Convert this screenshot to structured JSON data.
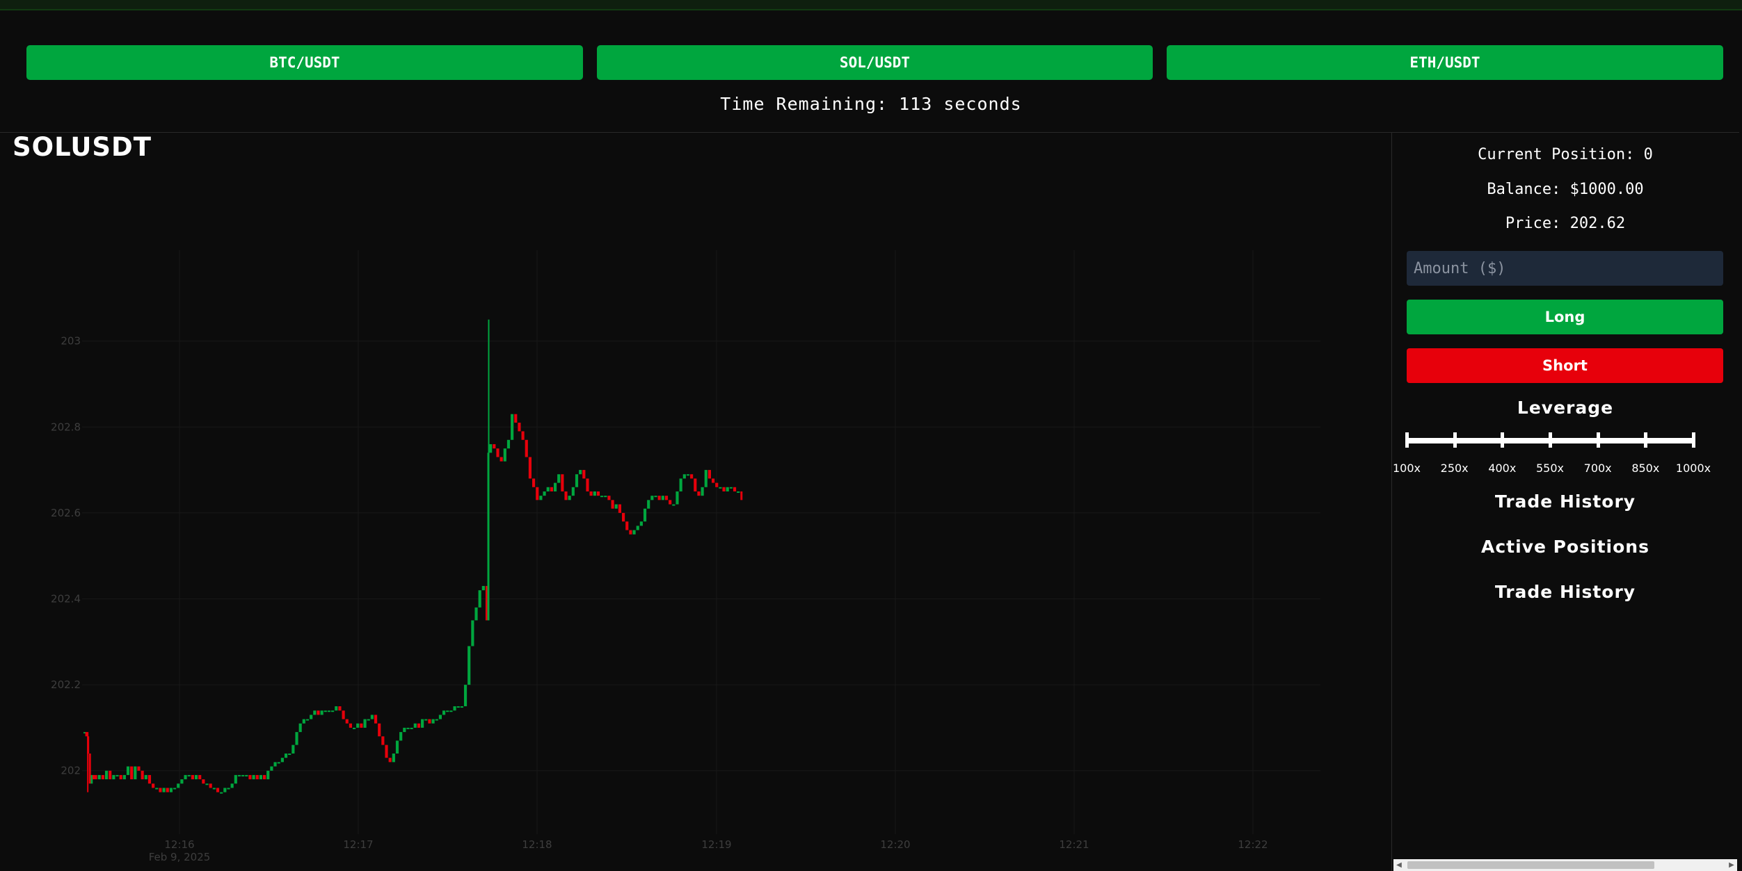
{
  "pairs": [
    {
      "label": "BTC/USDT"
    },
    {
      "label": "SOL/USDT"
    },
    {
      "label": "ETH/USDT"
    }
  ],
  "timer": {
    "text": "Time Remaining: 113 seconds"
  },
  "symbol": "SOLUSDT",
  "panel": {
    "position": "Current Position: 0",
    "balance": "Balance: $1000.00",
    "price": "Price: 202.62",
    "amount_placeholder": "Amount ($)",
    "long_label": "Long",
    "short_label": "Short",
    "leverage_title": "Leverage",
    "leverage_options": [
      "100x",
      "250x",
      "400x",
      "550x",
      "700x",
      "850x",
      "1000x"
    ],
    "leverage_selected": "1000x",
    "trade_history_title": "Trade History",
    "active_positions_title": "Active Positions",
    "trade_history_title_2": "Trade History"
  },
  "colors": {
    "up": "#00a63e",
    "down": "#e7000b",
    "background": "#0c0c0c",
    "input_bg": "#1e2939"
  },
  "chart_data": {
    "type": "candlestick",
    "y_ticks": [
      "203",
      "202.8",
      "202.6",
      "202.4",
      "202.2",
      "202"
    ],
    "x_ticks": [
      "12:16",
      "12:17",
      "12:18",
      "12:19",
      "12:20",
      "12:21",
      "12:22"
    ],
    "x_sublabel": "Feb 9, 2025",
    "ylim": [
      201.93,
      203.09
    ],
    "grid": true,
    "path": [
      [
        0,
        202.09
      ],
      [
        1,
        202.09
      ],
      [
        2,
        202.08
      ],
      [
        3,
        202.04
      ],
      [
        4,
        201.97
      ],
      [
        5,
        201.99
      ],
      [
        8,
        201.98
      ],
      [
        10,
        201.99
      ],
      [
        12,
        201.98
      ],
      [
        14,
        202.0
      ],
      [
        16,
        201.98
      ],
      [
        18,
        201.99
      ],
      [
        20,
        201.99
      ],
      [
        22,
        201.98
      ],
      [
        24,
        201.99
      ],
      [
        26,
        202.01
      ],
      [
        28,
        201.98
      ],
      [
        30,
        202.01
      ],
      [
        32,
        202.0
      ],
      [
        34,
        201.98
      ],
      [
        36,
        201.99
      ],
      [
        38,
        201.97
      ],
      [
        40,
        201.96
      ],
      [
        42,
        201.96
      ],
      [
        44,
        201.95
      ],
      [
        46,
        201.96
      ],
      [
        48,
        201.95
      ],
      [
        50,
        201.96
      ],
      [
        52,
        201.96
      ],
      [
        54,
        201.97
      ],
      [
        56,
        201.98
      ],
      [
        58,
        201.99
      ],
      [
        60,
        201.99
      ],
      [
        62,
        201.98
      ],
      [
        64,
        201.99
      ],
      [
        66,
        201.98
      ],
      [
        68,
        201.97
      ],
      [
        70,
        201.97
      ],
      [
        72,
        201.96
      ],
      [
        74,
        201.96
      ],
      [
        76,
        201.95
      ],
      [
        78,
        201.95
      ],
      [
        80,
        201.96
      ],
      [
        82,
        201.96
      ],
      [
        84,
        201.97
      ],
      [
        86,
        201.99
      ],
      [
        88,
        201.99
      ],
      [
        90,
        201.99
      ],
      [
        92,
        201.99
      ],
      [
        94,
        201.98
      ],
      [
        96,
        201.99
      ],
      [
        98,
        201.98
      ],
      [
        100,
        201.99
      ],
      [
        102,
        201.98
      ],
      [
        104,
        202.0
      ],
      [
        106,
        202.01
      ],
      [
        108,
        202.02
      ],
      [
        110,
        202.02
      ],
      [
        112,
        202.03
      ],
      [
        114,
        202.04
      ],
      [
        116,
        202.04
      ],
      [
        118,
        202.06
      ],
      [
        120,
        202.09
      ],
      [
        122,
        202.11
      ],
      [
        124,
        202.12
      ],
      [
        126,
        202.12
      ],
      [
        128,
        202.13
      ],
      [
        130,
        202.14
      ],
      [
        132,
        202.13
      ],
      [
        134,
        202.14
      ],
      [
        136,
        202.14
      ],
      [
        138,
        202.14
      ],
      [
        140,
        202.14
      ],
      [
        142,
        202.15
      ],
      [
        144,
        202.14
      ],
      [
        146,
        202.12
      ],
      [
        148,
        202.11
      ],
      [
        150,
        202.1
      ],
      [
        152,
        202.1
      ],
      [
        154,
        202.11
      ],
      [
        156,
        202.1
      ],
      [
        158,
        202.12
      ],
      [
        160,
        202.12
      ],
      [
        162,
        202.13
      ],
      [
        164,
        202.11
      ],
      [
        166,
        202.08
      ],
      [
        168,
        202.06
      ],
      [
        170,
        202.03
      ],
      [
        172,
        202.02
      ],
      [
        174,
        202.04
      ],
      [
        176,
        202.07
      ],
      [
        178,
        202.09
      ],
      [
        180,
        202.1
      ],
      [
        182,
        202.1
      ],
      [
        184,
        202.1
      ],
      [
        186,
        202.11
      ],
      [
        188,
        202.1
      ],
      [
        190,
        202.12
      ],
      [
        192,
        202.12
      ],
      [
        194,
        202.11
      ],
      [
        196,
        202.12
      ],
      [
        198,
        202.12
      ],
      [
        200,
        202.13
      ],
      [
        202,
        202.14
      ],
      [
        204,
        202.14
      ],
      [
        206,
        202.14
      ],
      [
        208,
        202.15
      ],
      [
        210,
        202.15
      ],
      [
        212,
        202.15
      ],
      [
        214,
        202.2
      ],
      [
        216,
        202.29
      ],
      [
        218,
        202.35
      ],
      [
        220,
        202.38
      ],
      [
        222,
        202.42
      ],
      [
        224,
        202.43
      ],
      [
        225,
        202.35
      ],
      [
        226,
        202.74
      ],
      [
        228,
        202.76
      ],
      [
        230,
        202.75
      ],
      [
        232,
        202.73
      ],
      [
        234,
        202.72
      ],
      [
        236,
        202.75
      ],
      [
        238,
        202.77
      ],
      [
        240,
        202.83
      ],
      [
        242,
        202.81
      ],
      [
        244,
        202.79
      ],
      [
        246,
        202.77
      ],
      [
        248,
        202.73
      ],
      [
        250,
        202.68
      ],
      [
        252,
        202.66
      ],
      [
        254,
        202.63
      ],
      [
        256,
        202.64
      ],
      [
        258,
        202.65
      ],
      [
        260,
        202.66
      ],
      [
        262,
        202.65
      ],
      [
        264,
        202.67
      ],
      [
        266,
        202.69
      ],
      [
        268,
        202.65
      ],
      [
        270,
        202.63
      ],
      [
        272,
        202.64
      ],
      [
        274,
        202.66
      ],
      [
        276,
        202.69
      ],
      [
        278,
        202.7
      ],
      [
        280,
        202.68
      ],
      [
        282,
        202.65
      ],
      [
        284,
        202.64
      ],
      [
        286,
        202.65
      ],
      [
        288,
        202.64
      ],
      [
        290,
        202.64
      ],
      [
        292,
        202.64
      ],
      [
        294,
        202.63
      ],
      [
        296,
        202.61
      ],
      [
        298,
        202.62
      ],
      [
        300,
        202.6
      ],
      [
        302,
        202.58
      ],
      [
        304,
        202.56
      ],
      [
        306,
        202.55
      ],
      [
        308,
        202.56
      ],
      [
        310,
        202.57
      ],
      [
        312,
        202.58
      ],
      [
        314,
        202.61
      ],
      [
        316,
        202.63
      ],
      [
        318,
        202.64
      ],
      [
        320,
        202.64
      ],
      [
        322,
        202.63
      ],
      [
        324,
        202.64
      ],
      [
        326,
        202.63
      ],
      [
        328,
        202.62
      ],
      [
        330,
        202.62
      ],
      [
        332,
        202.65
      ],
      [
        334,
        202.68
      ],
      [
        336,
        202.69
      ],
      [
        338,
        202.69
      ],
      [
        340,
        202.68
      ],
      [
        342,
        202.65
      ],
      [
        344,
        202.64
      ],
      [
        346,
        202.66
      ],
      [
        348,
        202.7
      ],
      [
        350,
        202.68
      ],
      [
        352,
        202.67
      ],
      [
        354,
        202.66
      ],
      [
        356,
        202.66
      ],
      [
        358,
        202.65
      ],
      [
        360,
        202.66
      ],
      [
        362,
        202.66
      ],
      [
        364,
        202.65
      ],
      [
        366,
        202.65
      ],
      [
        367,
        202.63
      ]
    ]
  }
}
